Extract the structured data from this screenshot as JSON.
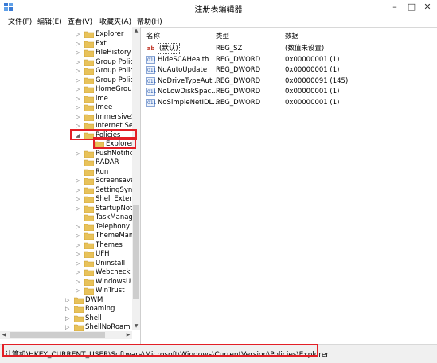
{
  "window": {
    "title": "注册表编辑器",
    "minimize": "–",
    "maximize": "□",
    "close": "✕"
  },
  "menu": [
    "文件(F)",
    "编辑(E)",
    "查看(V)",
    "收藏夹(A)",
    "帮助(H)"
  ],
  "tree": [
    {
      "label": "Explorer",
      "expander": "▷"
    },
    {
      "label": "Ext",
      "expander": "▷"
    },
    {
      "label": "FileHistory",
      "expander": "▷"
    },
    {
      "label": "Group Polic",
      "expander": "▷"
    },
    {
      "label": "Group Polic",
      "expander": "▷"
    },
    {
      "label": "Group Polic",
      "expander": "▷"
    },
    {
      "label": "HomeGroup",
      "expander": "▷"
    },
    {
      "label": "ime",
      "expander": "▷"
    },
    {
      "label": "Imee",
      "expander": "▷"
    },
    {
      "label": "ImmersiveS",
      "expander": "▷"
    },
    {
      "label": "Internet Set",
      "expander": "▷"
    },
    {
      "label": "Policies",
      "expander": "◢"
    },
    {
      "label": "Explorer",
      "expander": ""
    },
    {
      "label": "PushNotific",
      "expander": "▷"
    },
    {
      "label": "RADAR",
      "expander": ""
    },
    {
      "label": "Run",
      "expander": ""
    },
    {
      "label": "Screensaver",
      "expander": "▷"
    },
    {
      "label": "SettingSync",
      "expander": "▷"
    },
    {
      "label": "Shell Extens",
      "expander": "▷"
    },
    {
      "label": "StartupNoti",
      "expander": "▷"
    },
    {
      "label": "TaskManag",
      "expander": ""
    },
    {
      "label": "Telephony",
      "expander": "▷"
    },
    {
      "label": "ThemeMan",
      "expander": "▷"
    },
    {
      "label": "Themes",
      "expander": "▷"
    },
    {
      "label": "UFH",
      "expander": "▷"
    },
    {
      "label": "Uninstall",
      "expander": "▷"
    },
    {
      "label": "Webcheck",
      "expander": "▷"
    },
    {
      "label": "WindowsU",
      "expander": "▷"
    },
    {
      "label": "WinTrust",
      "expander": "▷"
    },
    {
      "label": "DWM",
      "expander": "▷"
    },
    {
      "label": "Roaming",
      "expander": "▷"
    },
    {
      "label": "Shell",
      "expander": "▷"
    },
    {
      "label": "ShellNoRoam",
      "expander": "▷"
    }
  ],
  "columns": {
    "name": "名称",
    "type": "类型",
    "data": "数据"
  },
  "values": [
    {
      "icon": "ab",
      "name": "(默认)",
      "type": "REG_SZ",
      "data": "(数值未设置)"
    },
    {
      "icon": "011",
      "name": "HideSCAHealth",
      "type": "REG_DWORD",
      "data": "0x00000001 (1)"
    },
    {
      "icon": "011",
      "name": "NoAutoUpdate",
      "type": "REG_DWORD",
      "data": "0x00000001 (1)"
    },
    {
      "icon": "011",
      "name": "NoDriveTypeAut...",
      "type": "REG_DWORD",
      "data": "0x00000091 (145)"
    },
    {
      "icon": "011",
      "name": "NoLowDiskSpac...",
      "type": "REG_DWORD",
      "data": "0x00000001 (1)"
    },
    {
      "icon": "011",
      "name": "NoSimpleNetIDL...",
      "type": "REG_DWORD",
      "data": "0x00000001 (1)"
    }
  ],
  "status": {
    "path": "计算机\\HKEY_CURRENT_USER\\Software\\Microsoft\\Windows\\CurrentVersion\\Policies\\Explorer"
  },
  "colors": {
    "highlight": "#e31f26",
    "folder": "#e8c25a"
  }
}
